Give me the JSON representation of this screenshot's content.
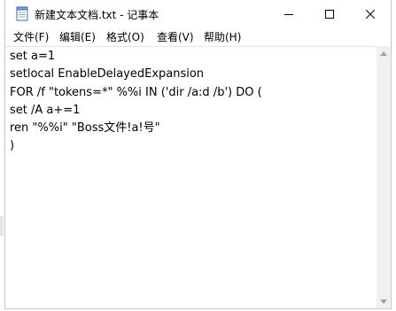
{
  "window": {
    "title": "新建文本文档.txt - 记事本",
    "icon": "notepad-icon"
  },
  "controls": {
    "minimize_icon": "minimize-icon",
    "maximize_icon": "maximize-icon",
    "close_icon": "close-icon"
  },
  "menu": [
    {
      "label": "文件(F)"
    },
    {
      "label": "编辑(E)"
    },
    {
      "label": "格式(O)"
    },
    {
      "label": "查看(V)"
    },
    {
      "label": "帮助(H)"
    }
  ],
  "editor": {
    "lines": [
      "set a=1",
      "setlocal EnableDelayedExpansion",
      "FOR /f \"tokens=*\" %%i IN ('dir /a:d /b') DO (",
      "set /A a+=1",
      "ren \"%%i\" \"Boss文件!a!号\"",
      ")"
    ]
  },
  "colors": {
    "background": "#ffffff",
    "text": "#000000",
    "scrollbar": "#f0f0f0"
  }
}
